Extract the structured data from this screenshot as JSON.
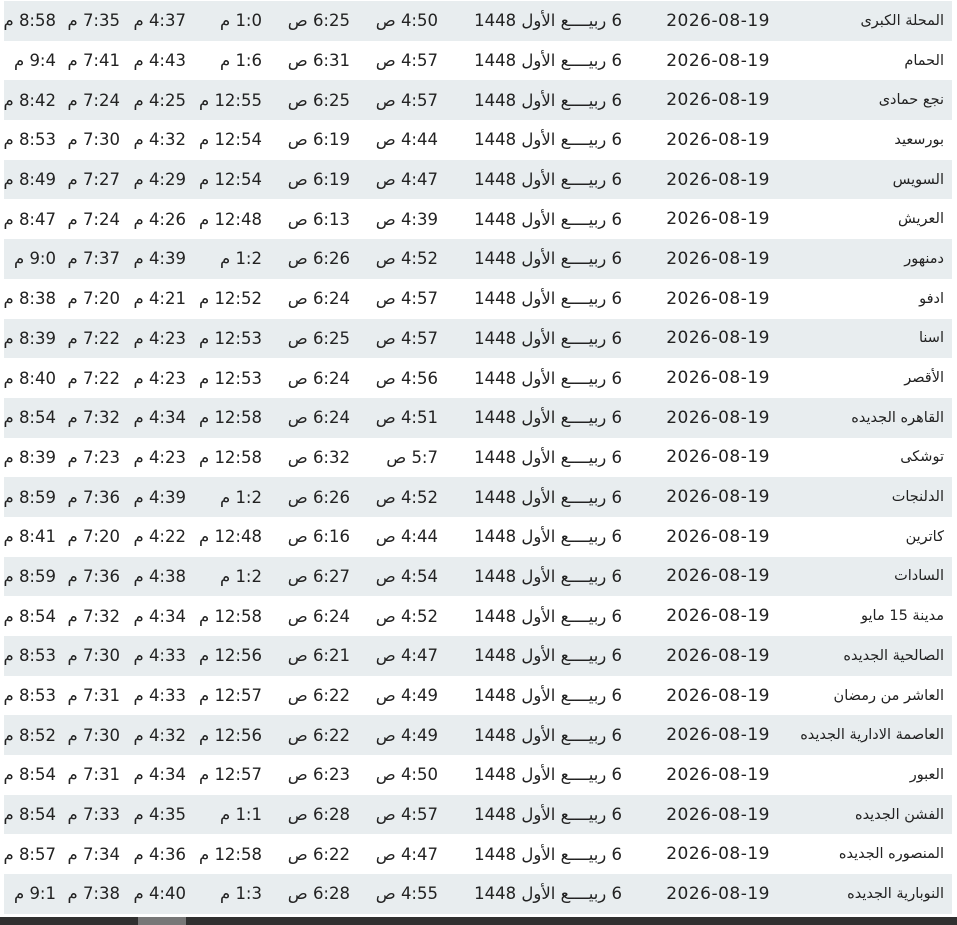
{
  "rows": [
    {
      "city": "المحلة الكبرى",
      "date": "2026-08-19",
      "hijri": "6 ربيــــع الأول 1448",
      "fajr": "4:50 ص",
      "sunrise": "6:25 ص",
      "dhuhr": "1:0 م",
      "asr": "4:37 م",
      "maghrib": "7:35 م",
      "isha": "8:58 م"
    },
    {
      "city": "الحمام",
      "date": "2026-08-19",
      "hijri": "6 ربيــــع الأول 1448",
      "fajr": "4:57 ص",
      "sunrise": "6:31 ص",
      "dhuhr": "1:6 م",
      "asr": "4:43 م",
      "maghrib": "7:41 م",
      "isha": "9:4 م"
    },
    {
      "city": "نجع حمادى",
      "date": "2026-08-19",
      "hijri": "6 ربيــــع الأول 1448",
      "fajr": "4:57 ص",
      "sunrise": "6:25 ص",
      "dhuhr": "12:55 م",
      "asr": "4:25 م",
      "maghrib": "7:24 م",
      "isha": "8:42 م"
    },
    {
      "city": "بورسعيد",
      "date": "2026-08-19",
      "hijri": "6 ربيــــع الأول 1448",
      "fajr": "4:44 ص",
      "sunrise": "6:19 ص",
      "dhuhr": "12:54 م",
      "asr": "4:32 م",
      "maghrib": "7:30 م",
      "isha": "8:53 م"
    },
    {
      "city": "السويس",
      "date": "2026-08-19",
      "hijri": "6 ربيــــع الأول 1448",
      "fajr": "4:47 ص",
      "sunrise": "6:19 ص",
      "dhuhr": "12:54 م",
      "asr": "4:29 م",
      "maghrib": "7:27 م",
      "isha": "8:49 م"
    },
    {
      "city": "العريش",
      "date": "2026-08-19",
      "hijri": "6 ربيــــع الأول 1448",
      "fajr": "4:39 ص",
      "sunrise": "6:13 ص",
      "dhuhr": "12:48 م",
      "asr": "4:26 م",
      "maghrib": "7:24 م",
      "isha": "8:47 م"
    },
    {
      "city": "دمنهور",
      "date": "2026-08-19",
      "hijri": "6 ربيــــع الأول 1448",
      "fajr": "4:52 ص",
      "sunrise": "6:26 ص",
      "dhuhr": "1:2 م",
      "asr": "4:39 م",
      "maghrib": "7:37 م",
      "isha": "9:0 م"
    },
    {
      "city": "ادفو",
      "date": "2026-08-19",
      "hijri": "6 ربيــــع الأول 1448",
      "fajr": "4:57 ص",
      "sunrise": "6:24 ص",
      "dhuhr": "12:52 م",
      "asr": "4:21 م",
      "maghrib": "7:20 م",
      "isha": "8:38 م"
    },
    {
      "city": "اسنا",
      "date": "2026-08-19",
      "hijri": "6 ربيــــع الأول 1448",
      "fajr": "4:57 ص",
      "sunrise": "6:25 ص",
      "dhuhr": "12:53 م",
      "asr": "4:23 م",
      "maghrib": "7:22 م",
      "isha": "8:39 م"
    },
    {
      "city": "الأقصر",
      "date": "2026-08-19",
      "hijri": "6 ربيــــع الأول 1448",
      "fajr": "4:56 ص",
      "sunrise": "6:24 ص",
      "dhuhr": "12:53 م",
      "asr": "4:23 م",
      "maghrib": "7:22 م",
      "isha": "8:40 م"
    },
    {
      "city": "القاهره الجديده",
      "date": "2026-08-19",
      "hijri": "6 ربيــــع الأول 1448",
      "fajr": "4:51 ص",
      "sunrise": "6:24 ص",
      "dhuhr": "12:58 م",
      "asr": "4:34 م",
      "maghrib": "7:32 م",
      "isha": "8:54 م"
    },
    {
      "city": "توشكى",
      "date": "2026-08-19",
      "hijri": "6 ربيــــع الأول 1448",
      "fajr": "5:7 ص",
      "sunrise": "6:32 ص",
      "dhuhr": "12:58 م",
      "asr": "4:23 م",
      "maghrib": "7:23 م",
      "isha": "8:39 م"
    },
    {
      "city": "الدلنجات",
      "date": "2026-08-19",
      "hijri": "6 ربيــــع الأول 1448",
      "fajr": "4:52 ص",
      "sunrise": "6:26 ص",
      "dhuhr": "1:2 م",
      "asr": "4:39 م",
      "maghrib": "7:36 م",
      "isha": "8:59 م"
    },
    {
      "city": "كاترين",
      "date": "2026-08-19",
      "hijri": "6 ربيــــع الأول 1448",
      "fajr": "4:44 ص",
      "sunrise": "6:16 ص",
      "dhuhr": "12:48 م",
      "asr": "4:22 م",
      "maghrib": "7:20 م",
      "isha": "8:41 م"
    },
    {
      "city": "السادات",
      "date": "2026-08-19",
      "hijri": "6 ربيــــع الأول 1448",
      "fajr": "4:54 ص",
      "sunrise": "6:27 ص",
      "dhuhr": "1:2 م",
      "asr": "4:38 م",
      "maghrib": "7:36 م",
      "isha": "8:59 م"
    },
    {
      "city": "مدينة 15 مايو",
      "date": "2026-08-19",
      "hijri": "6 ربيــــع الأول 1448",
      "fajr": "4:52 ص",
      "sunrise": "6:24 ص",
      "dhuhr": "12:58 م",
      "asr": "4:34 م",
      "maghrib": "7:32 م",
      "isha": "8:54 م"
    },
    {
      "city": "الصالحية الجديده",
      "date": "2026-08-19",
      "hijri": "6 ربيــــع الأول 1448",
      "fajr": "4:47 ص",
      "sunrise": "6:21 ص",
      "dhuhr": "12:56 م",
      "asr": "4:33 م",
      "maghrib": "7:30 م",
      "isha": "8:53 م"
    },
    {
      "city": "العاشر من رمضان",
      "date": "2026-08-19",
      "hijri": "6 ربيــــع الأول 1448",
      "fajr": "4:49 ص",
      "sunrise": "6:22 ص",
      "dhuhr": "12:57 م",
      "asr": "4:33 م",
      "maghrib": "7:31 م",
      "isha": "8:53 م"
    },
    {
      "city": "العاصمة الادارية الجديده",
      "date": "2026-08-19",
      "hijri": "6 ربيــــع الأول 1448",
      "fajr": "4:49 ص",
      "sunrise": "6:22 ص",
      "dhuhr": "12:56 م",
      "asr": "4:32 م",
      "maghrib": "7:30 م",
      "isha": "8:52 م"
    },
    {
      "city": "العبور",
      "date": "2026-08-19",
      "hijri": "6 ربيــــع الأول 1448",
      "fajr": "4:50 ص",
      "sunrise": "6:23 ص",
      "dhuhr": "12:57 م",
      "asr": "4:34 م",
      "maghrib": "7:31 م",
      "isha": "8:54 م"
    },
    {
      "city": "الفشن الجديده",
      "date": "2026-08-19",
      "hijri": "6 ربيــــع الأول 1448",
      "fajr": "4:57 ص",
      "sunrise": "6:28 ص",
      "dhuhr": "1:1 م",
      "asr": "4:35 م",
      "maghrib": "7:33 م",
      "isha": "8:54 م"
    },
    {
      "city": "المنصوره الجديده",
      "date": "2026-08-19",
      "hijri": "6 ربيــــع الأول 1448",
      "fajr": "4:47 ص",
      "sunrise": "6:22 ص",
      "dhuhr": "12:58 م",
      "asr": "4:36 م",
      "maghrib": "7:34 م",
      "isha": "8:57 م"
    },
    {
      "city": "النوبارية الجديده",
      "date": "2026-08-19",
      "hijri": "6 ربيــــع الأول 1448",
      "fajr": "4:55 ص",
      "sunrise": "6:28 ص",
      "dhuhr": "1:3 م",
      "asr": "4:40 م",
      "maghrib": "7:38 م",
      "isha": "9:1 م"
    }
  ],
  "colors": {
    "row_alt": "#e8edef",
    "row_plain": "#ffffff",
    "text": "#222222",
    "scrollbar_track": "#303030",
    "scrollbar_thumb": "#777777"
  }
}
